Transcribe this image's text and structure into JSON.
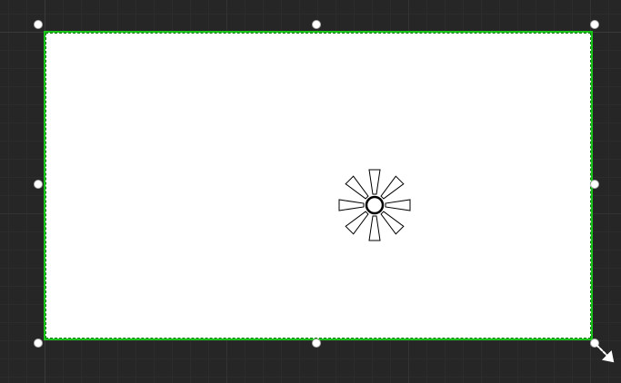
{
  "canvas": {
    "background": "#262626",
    "grid_major_color": "#333333",
    "grid_minor_color": "#2c2c2c"
  },
  "frame": {
    "fill": "#ffffff",
    "border_color": "#19c319",
    "selected": true
  },
  "content": {
    "icon": "loading-spinner-icon"
  },
  "selection_handles": [
    "top-left",
    "top-center",
    "top-right",
    "middle-left",
    "middle-right",
    "bottom-left",
    "bottom-center",
    "bottom-right"
  ],
  "cursor": {
    "icon": "resize-diagonal-cursor-icon"
  }
}
